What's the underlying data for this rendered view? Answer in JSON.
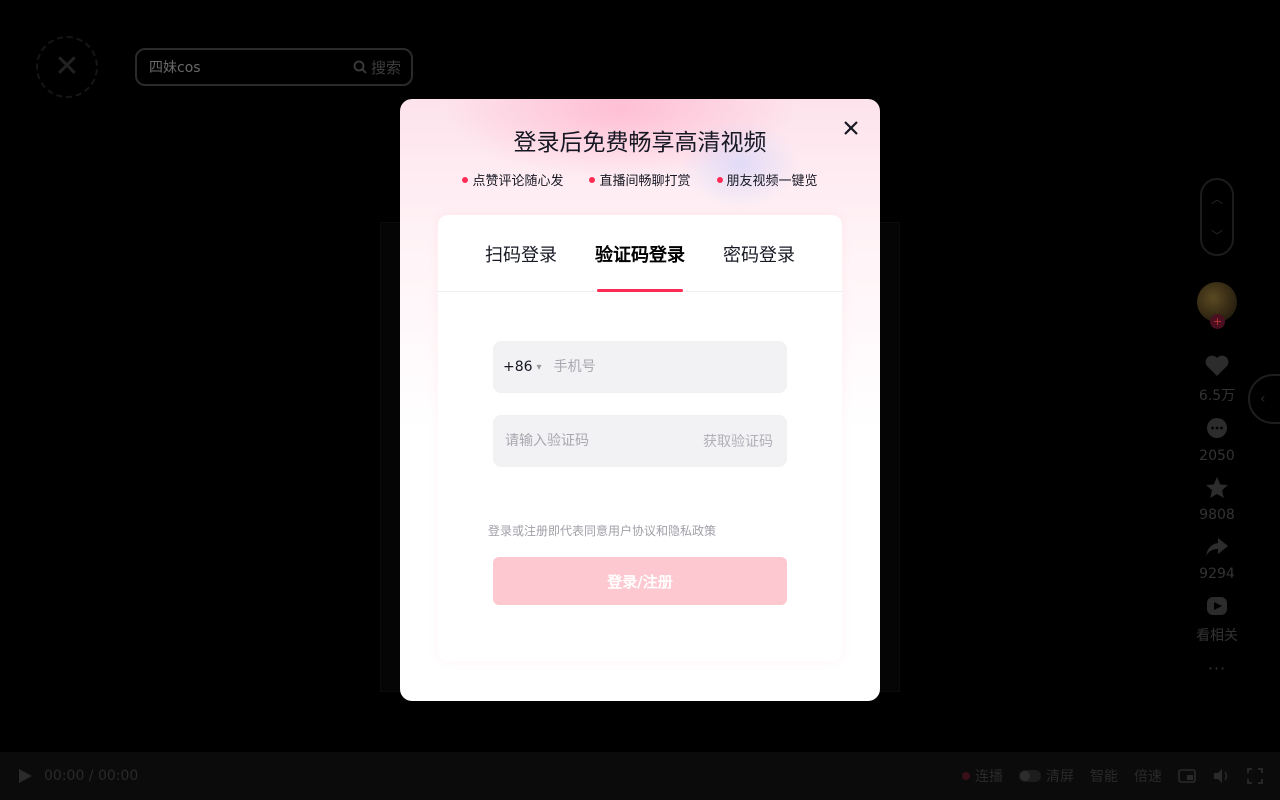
{
  "header": {
    "logo_label": "✕",
    "search": {
      "value": "四妹cos",
      "button_label": "搜索"
    }
  },
  "rail": {
    "likes": "6.5万",
    "comments": "2050",
    "favorites": "9808",
    "shares": "9294",
    "related": "看相关",
    "more": "···"
  },
  "player": {
    "time": "00:00 / 00:00",
    "controls": [
      {
        "label": "连播",
        "icon": "record-dot-icon"
      },
      {
        "label": "清屏",
        "icon": "toggle-icon"
      },
      {
        "label": "智能"
      },
      {
        "label": "倍速"
      }
    ]
  },
  "login": {
    "title": "登录后免费畅享高清视频",
    "perks": [
      "点赞评论随心发",
      "直播间畅聊打赏",
      "朋友视频一键览"
    ],
    "tabs": [
      "扫码登录",
      "验证码登录",
      "密码登录"
    ],
    "active_tab": 1,
    "country_code": "+86",
    "phone_placeholder": "手机号",
    "code_placeholder": "请输入验证码",
    "get_code": "获取验证码",
    "agreement_prefix": "登录或注册即代表同意",
    "user_agreement": "用户协议",
    "and": "和",
    "privacy_policy": "隐私政策",
    "submit": "登录/注册"
  },
  "colors": {
    "accent": "#fe2c55",
    "submit_disabled": "#fec8d0"
  }
}
